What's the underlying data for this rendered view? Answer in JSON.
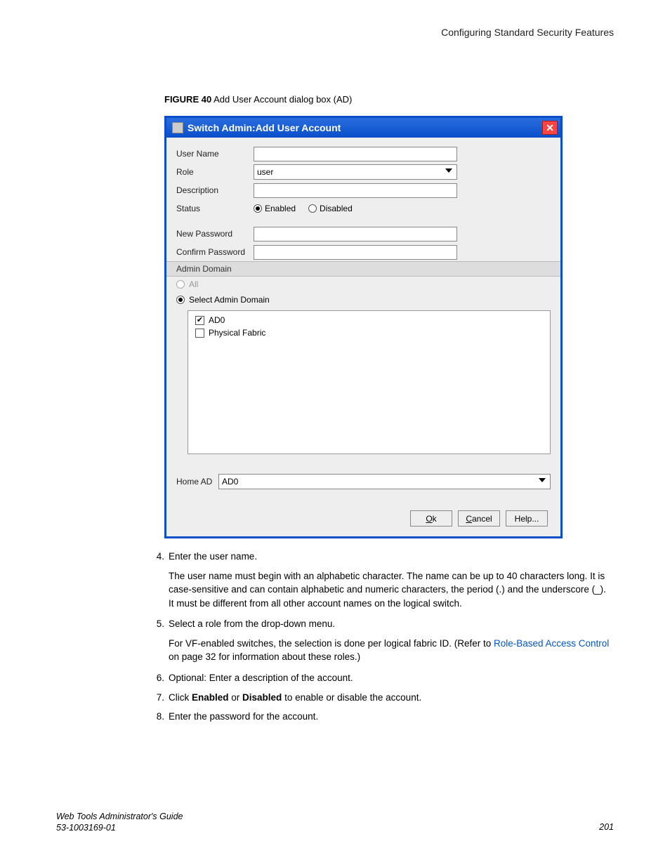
{
  "header": {
    "title": "Configuring Standard Security Features"
  },
  "figure": {
    "label": "FIGURE 40",
    "caption": "Add User Account dialog box (AD)"
  },
  "dialog": {
    "title": "Switch Admin:Add User Account",
    "labels": {
      "username": "User Name",
      "role": "Role",
      "description": "Description",
      "status": "Status",
      "newpw": "New Password",
      "confirmpw": "Confirm Password",
      "section": "Admin Domain",
      "all": "All",
      "selectAD": "Select Admin Domain",
      "homeAD": "Home AD"
    },
    "role_value": "user",
    "status_options": {
      "enabled": "Enabled",
      "disabled": "Disabled"
    },
    "status_selected": "enabled",
    "ad_mode": "select",
    "ad_items": [
      {
        "label": "AD0",
        "checked": true
      },
      {
        "label": "Physical Fabric",
        "checked": false
      }
    ],
    "homeAD_value": "AD0",
    "buttons": {
      "ok": "Ok",
      "cancel": "Cancel",
      "help": "Help..."
    }
  },
  "steps": {
    "s4": "Enter the user name.",
    "s4_sub": "The user name must begin with an alphabetic character. The name can be up to 40 characters long. It is case-sensitive and can contain alphabetic and numeric characters, the period (.) and the underscore (_). It must be different from all other account names on the logical switch.",
    "s5": "Select a role from the drop-down menu.",
    "s5_sub_a": "For VF-enabled switches, the selection is done per logical fabric ID. (Refer to ",
    "s5_link": "Role-Based Access Control",
    "s5_sub_b": " on page 32 for information about these roles.)",
    "s6": "Optional: Enter a description of the account.",
    "s7_a": "Click ",
    "s7_b1": "Enabled",
    "s7_c": " or ",
    "s7_b2": "Disabled",
    "s7_d": " to enable or disable the account.",
    "s8": "Enter the password for the account."
  },
  "footer": {
    "guide": "Web Tools Administrator's Guide",
    "docnum": "53-1003169-01",
    "pagenum": "201"
  }
}
